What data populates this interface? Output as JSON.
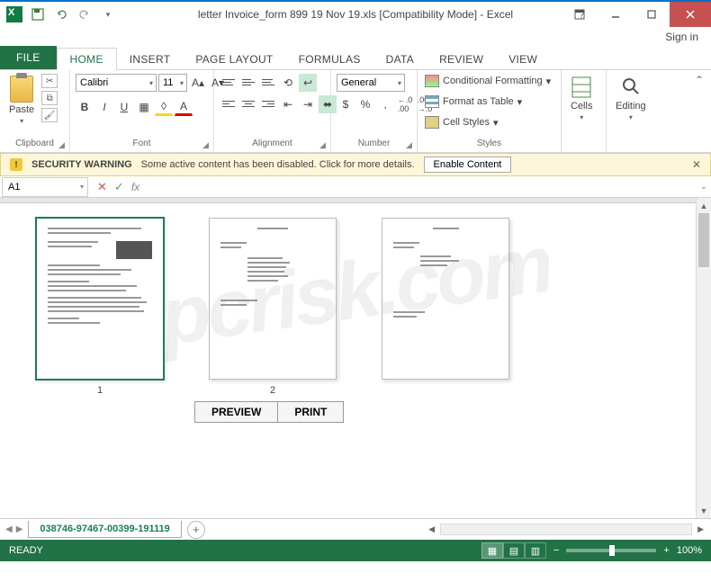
{
  "titlebar": {
    "document_title": "letter Invoice_form 899 19 Nov 19.xls  [Compatibility Mode] - Excel"
  },
  "signin": {
    "label": "Sign in"
  },
  "tabs": {
    "file": "FILE",
    "items": [
      "HOME",
      "INSERT",
      "PAGE LAYOUT",
      "FORMULAS",
      "DATA",
      "REVIEW",
      "VIEW"
    ],
    "active_index": 0
  },
  "ribbon": {
    "clipboard": {
      "label": "Clipboard",
      "paste": "Paste"
    },
    "font": {
      "label": "Font",
      "font_name": "Calibri",
      "font_size": "11",
      "bold": "B",
      "italic": "I",
      "underline": "U"
    },
    "alignment": {
      "label": "Alignment"
    },
    "number": {
      "label": "Number",
      "format": "General",
      "inc_dec": ".0",
      "dec_inc": ".00"
    },
    "styles": {
      "label": "Styles",
      "conditional": "Conditional Formatting",
      "table": "Format as Table",
      "cell": "Cell Styles"
    },
    "cells": {
      "label": "Cells"
    },
    "editing": {
      "label": "Editing"
    }
  },
  "security": {
    "heading": "SECURITY WARNING",
    "message": "Some active content has been disabled. Click for more details.",
    "button": "Enable Content"
  },
  "formula_bar": {
    "name_box": "A1",
    "fx": "fx"
  },
  "content": {
    "page_labels": [
      "1",
      "2"
    ],
    "actions": {
      "preview": "PREVIEW",
      "print": "PRINT"
    }
  },
  "sheet": {
    "tab_name": "038746-97467-00399-191119"
  },
  "status": {
    "ready": "READY",
    "zoom": "100%"
  },
  "watermark": "pcrisk.com"
}
